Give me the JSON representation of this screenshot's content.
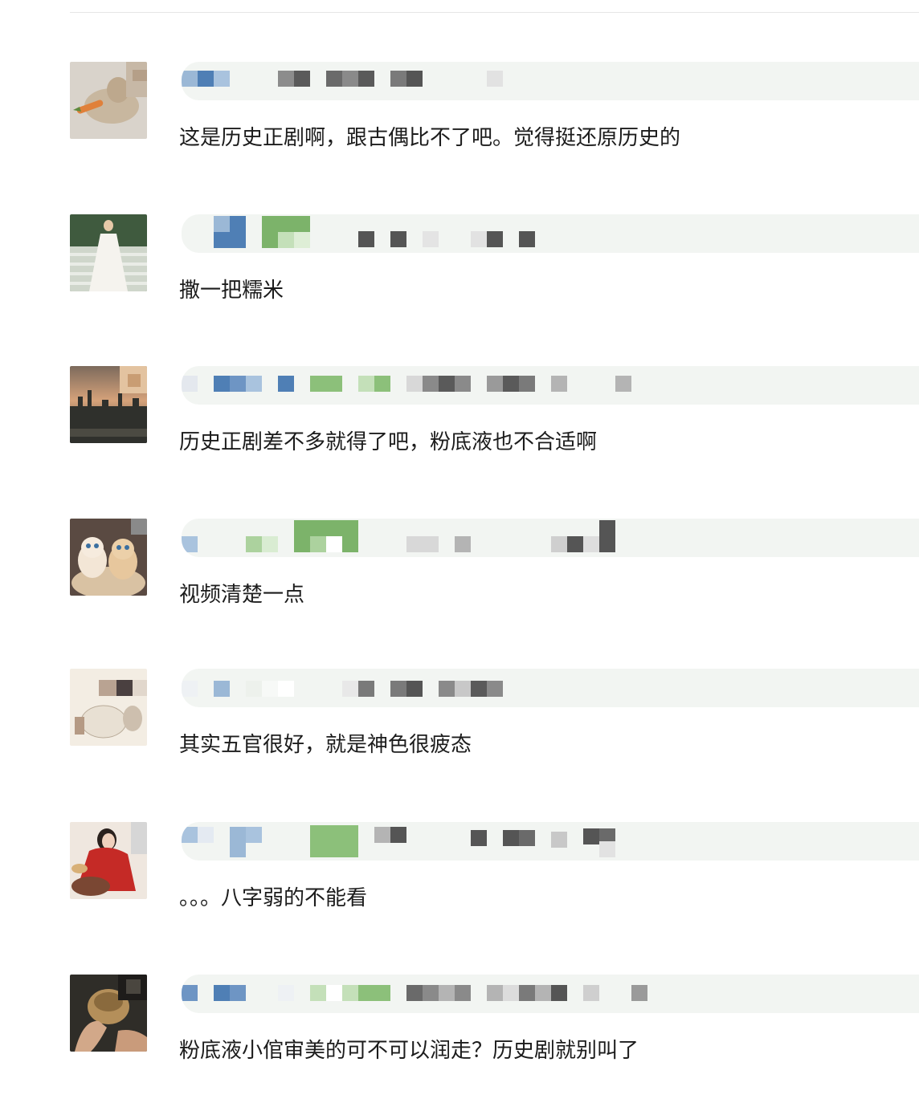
{
  "comments": [
    {
      "avatar": "avatar-cat-with-carrot",
      "text": "这是历史正剧啊，跟古偶比不了吧。觉得挺还原历史的"
    },
    {
      "avatar": "avatar-woman-white-gown",
      "text": "撒一把糯米"
    },
    {
      "avatar": "avatar-city-skyline",
      "text": "历史正剧差不多就得了吧，粉底液也不合适啊"
    },
    {
      "avatar": "avatar-two-kittens",
      "text": "视频清楚一点"
    },
    {
      "avatar": "avatar-cat-illustration",
      "text": "其实五官很好，就是神色很疲态"
    },
    {
      "avatar": "avatar-woman-red-dress",
      "text": "。。。八字弱的不能看"
    },
    {
      "avatar": "avatar-person-holding-bowl",
      "text": "粉底液小倌审美的可不可以润走？历史剧就别叫了"
    }
  ]
}
